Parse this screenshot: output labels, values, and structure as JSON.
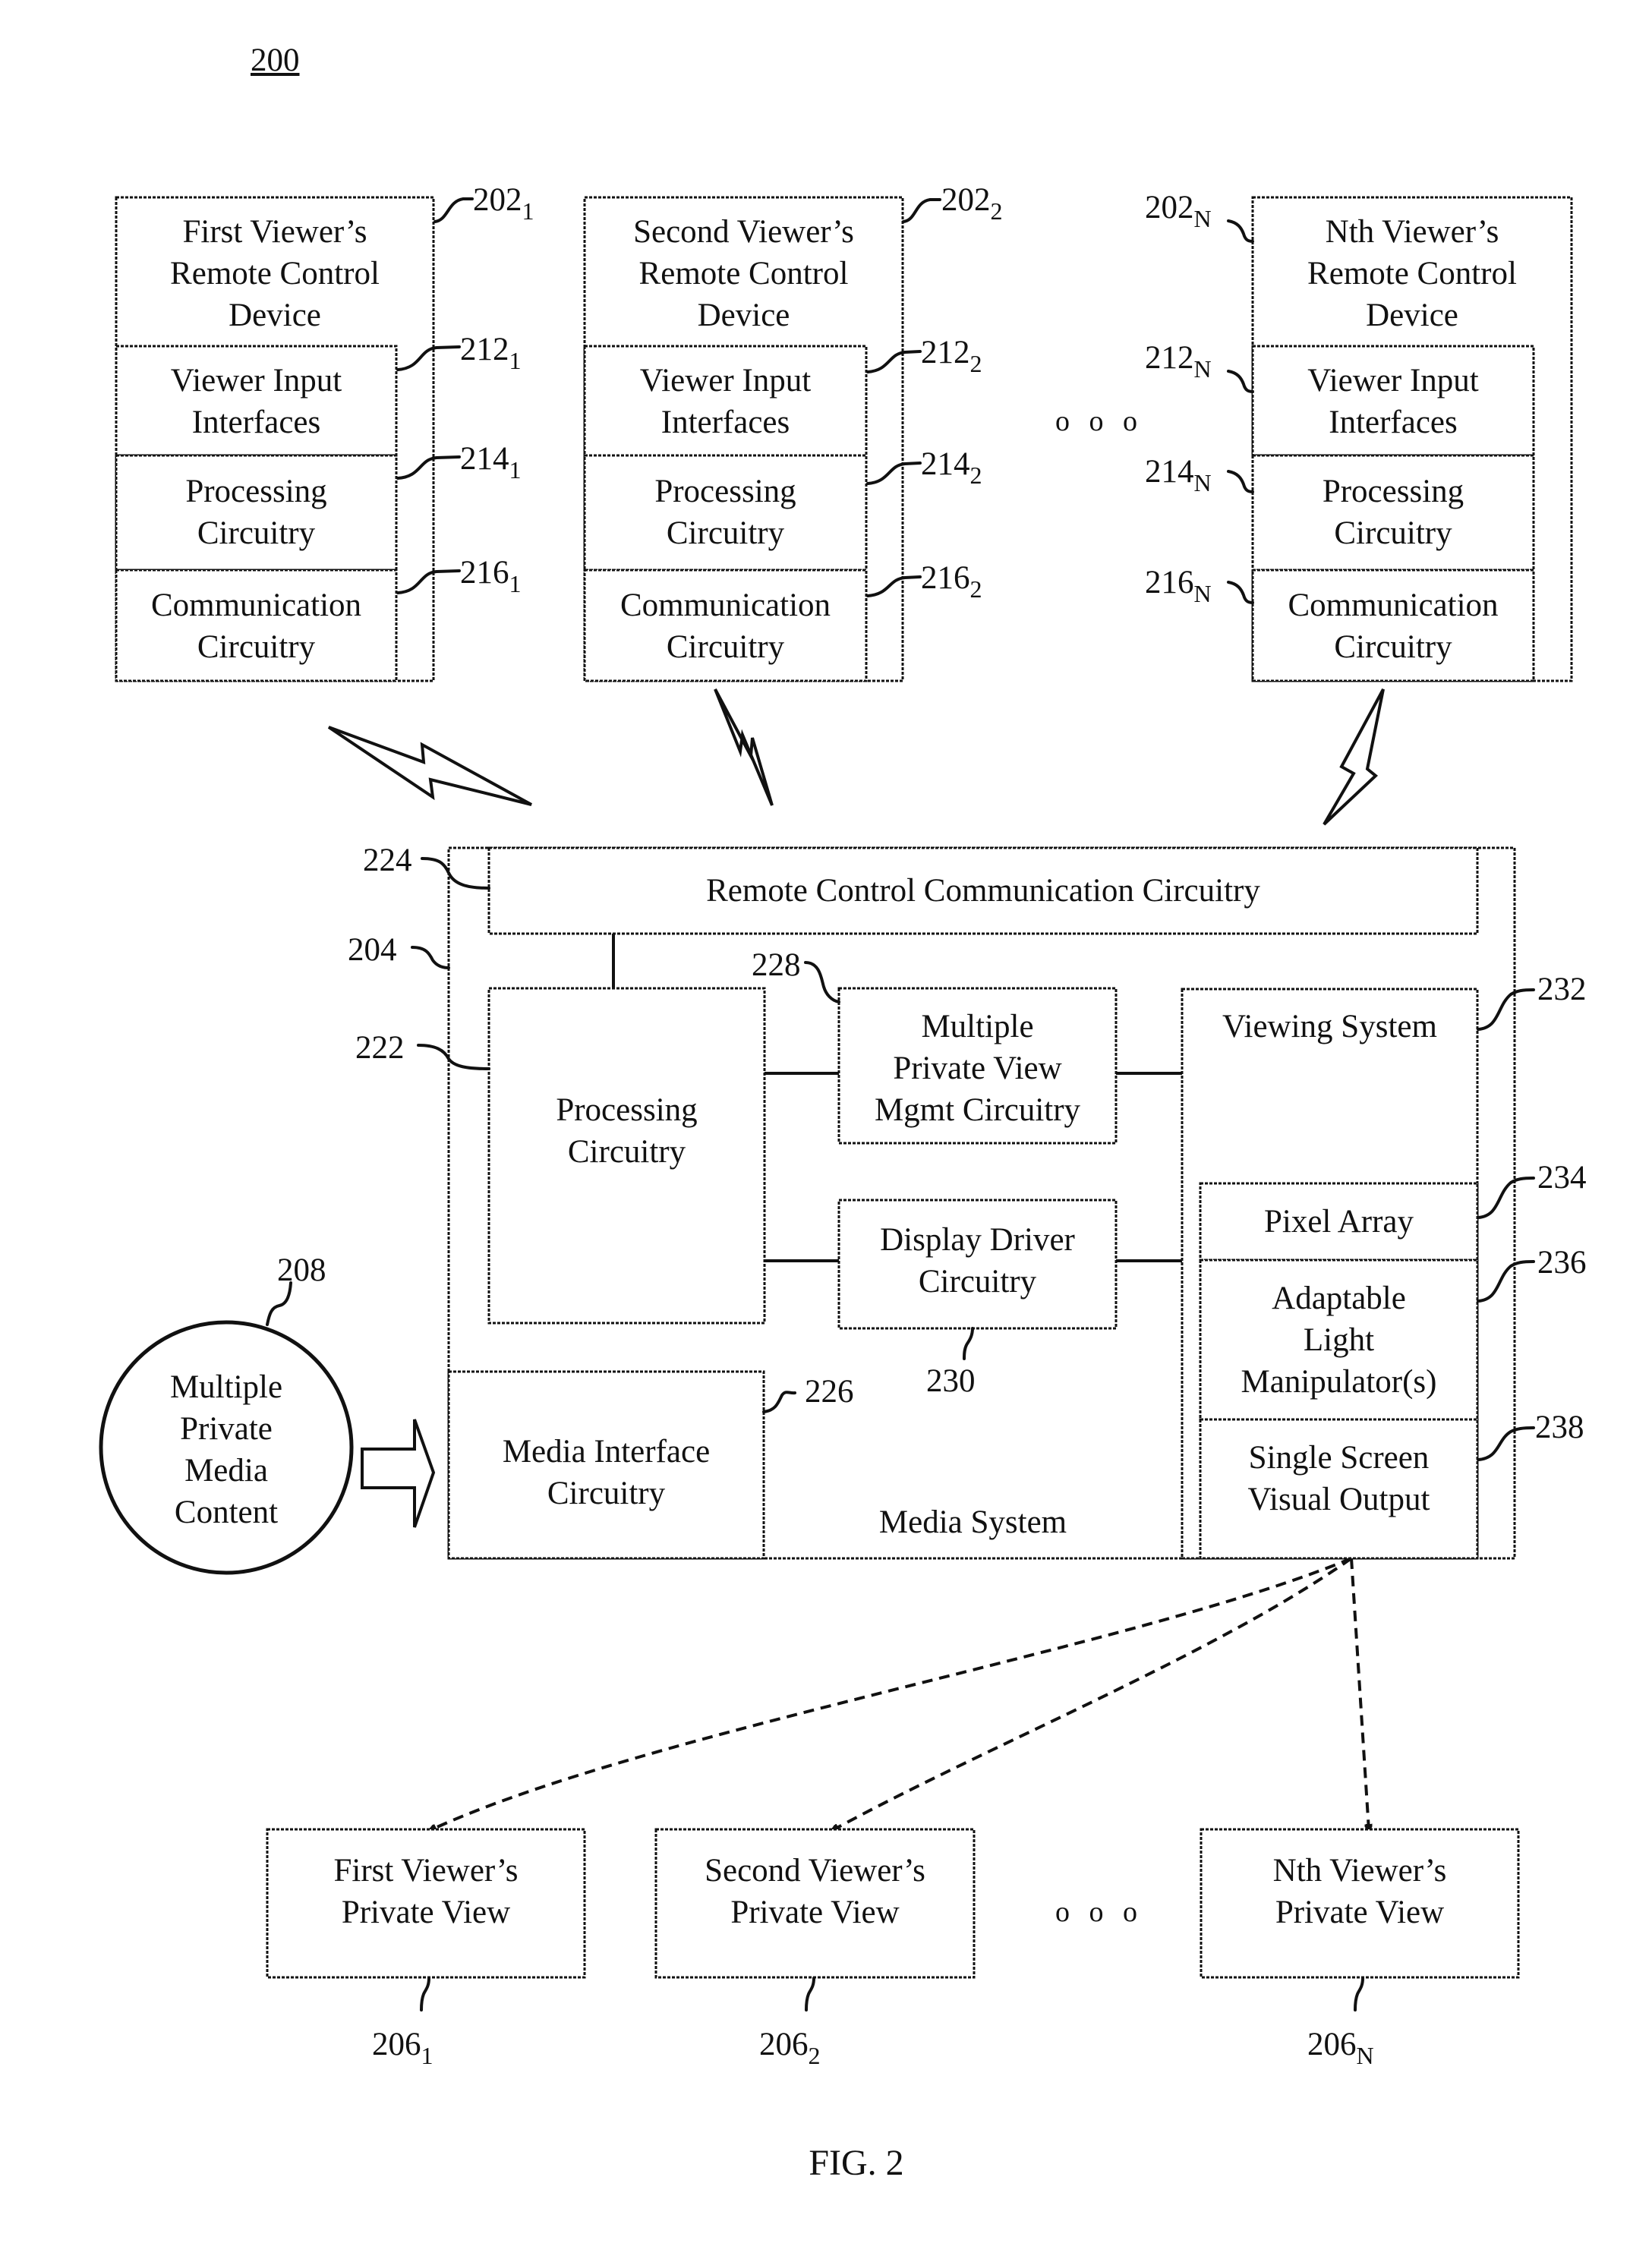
{
  "figure": {
    "number": "200",
    "caption": "FIG. 2"
  },
  "remote_devices": [
    {
      "title": "First Viewer’s\nRemote Control\nDevice",
      "ref": "202",
      "ref_sub": "1",
      "components": [
        {
          "label": "Viewer Input\nInterfaces",
          "ref": "212",
          "ref_sub": "1"
        },
        {
          "label": "Processing\nCircuitry",
          "ref": "214",
          "ref_sub": "1"
        },
        {
          "label": "Communication\nCircuitry",
          "ref": "216",
          "ref_sub": "1"
        }
      ]
    },
    {
      "title": "Second Viewer’s\nRemote Control\nDevice",
      "ref": "202",
      "ref_sub": "2",
      "components": [
        {
          "label": "Viewer Input\nInterfaces",
          "ref": "212",
          "ref_sub": "2"
        },
        {
          "label": "Processing\nCircuitry",
          "ref": "214",
          "ref_sub": "2"
        },
        {
          "label": "Communication\nCircuitry",
          "ref": "216",
          "ref_sub": "2"
        }
      ]
    },
    {
      "title": "Nth Viewer’s\nRemote Control\nDevice",
      "ref": "202",
      "ref_sub": "N",
      "components": [
        {
          "label": "Viewer Input\nInterfaces",
          "ref": "212",
          "ref_sub": "N"
        },
        {
          "label": "Processing\nCircuitry",
          "ref": "214",
          "ref_sub": "N"
        },
        {
          "label": "Communication\nCircuitry",
          "ref": "216",
          "ref_sub": "N"
        }
      ]
    }
  ],
  "ellipsis": "o o o",
  "media_system": {
    "label": "Media System",
    "ref": "204",
    "remote_comm": {
      "label": "Remote Control Communication Circuitry",
      "ref": "224"
    },
    "processing": {
      "label": "Processing\nCircuitry",
      "ref": "222"
    },
    "mgmt": {
      "label": "Multiple\nPrivate View\nMgmt Circuitry",
      "ref": "228"
    },
    "display_driver": {
      "label": "Display Driver\nCircuitry",
      "ref": "230"
    },
    "media_interface": {
      "label": "Media Interface\nCircuitry",
      "ref": "226"
    },
    "viewing_system": {
      "label": "Viewing System",
      "ref": "232",
      "pixel_array": {
        "label": "Pixel Array",
        "ref": "234"
      },
      "light_manipulator": {
        "label": "Adaptable\nLight\nManipulator(s)",
        "ref": "236"
      },
      "single_screen": {
        "label": "Single Screen\nVisual Output",
        "ref": "238"
      }
    }
  },
  "media_content": {
    "label": "Multiple\nPrivate\nMedia\nContent",
    "ref": "208"
  },
  "private_views": [
    {
      "label": "First Viewer’s\nPrivate View",
      "ref": "206",
      "ref_sub": "1"
    },
    {
      "label": "Second Viewer’s\nPrivate View",
      "ref": "206",
      "ref_sub": "2"
    },
    {
      "label": "Nth Viewer’s\nPrivate View",
      "ref": "206",
      "ref_sub": "N"
    }
  ]
}
